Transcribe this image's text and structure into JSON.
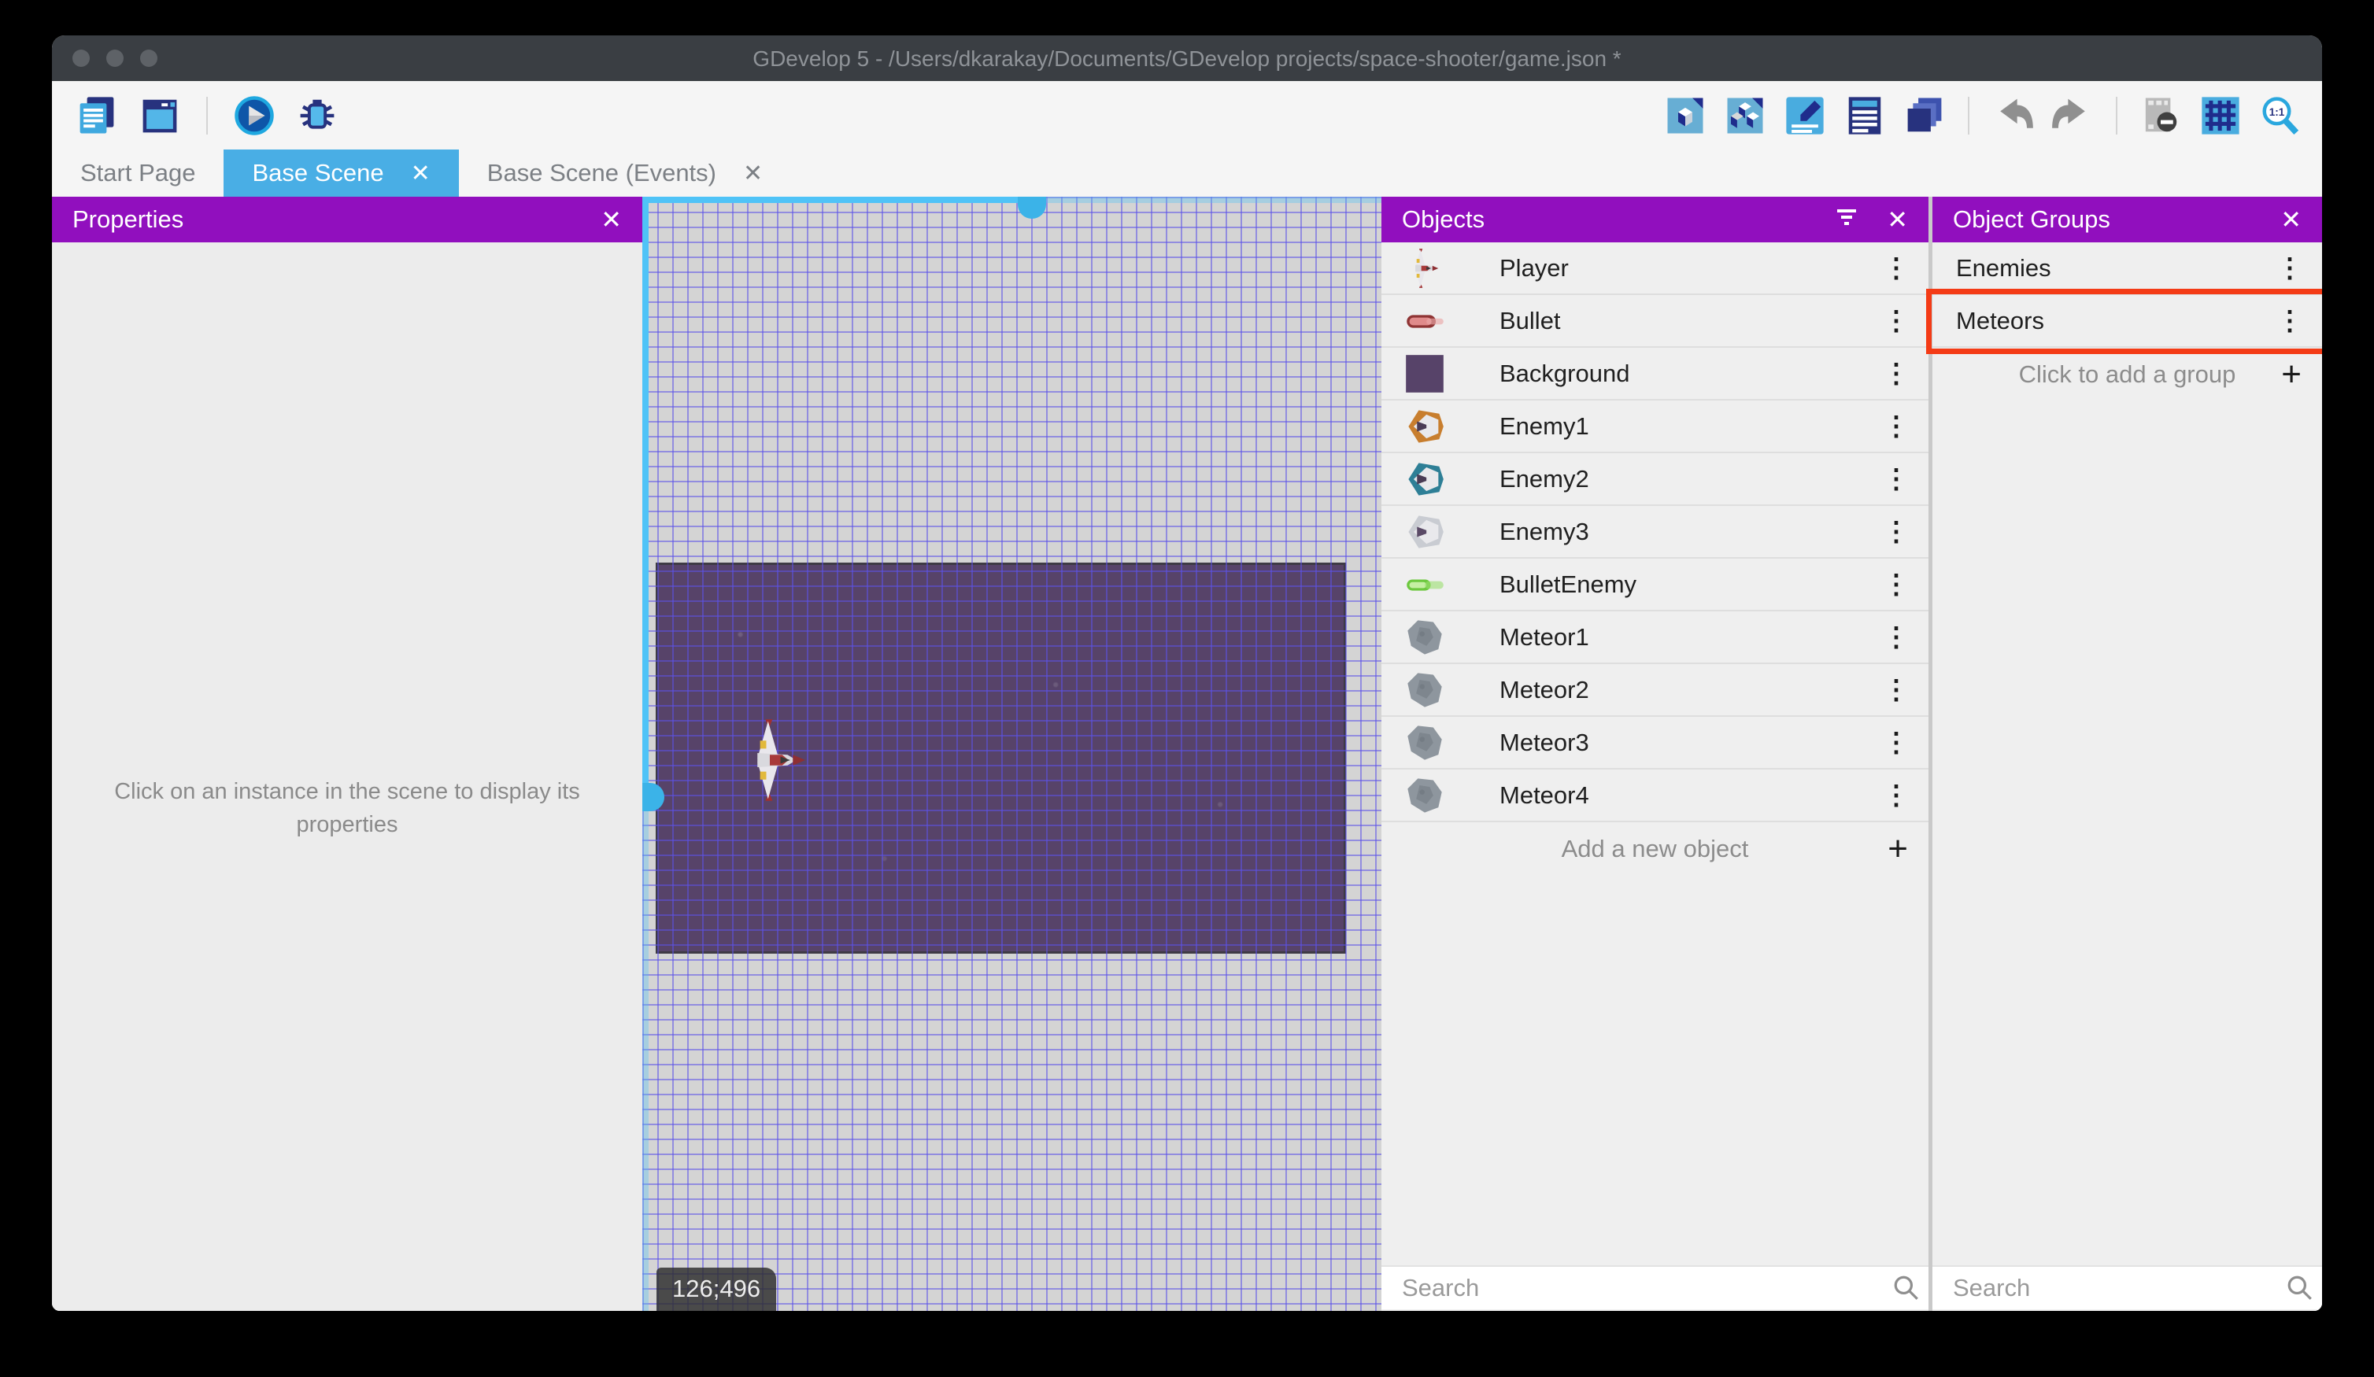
{
  "window": {
    "title": "GDevelop 5 - /Users/dkarakay/Documents/GDevelop projects/space-shooter/game.json *"
  },
  "toolbar": {
    "left_icons": [
      "project-manager-icon",
      "scene-editor-icon",
      "divider",
      "play-icon",
      "debug-icon"
    ],
    "right_icons": [
      "object-icon",
      "object-groups-icon",
      "edit-properties-icon",
      "instances-list-icon",
      "layers-icon",
      "divider",
      "undo-icon",
      "redo-icon",
      "divider",
      "mask-icon",
      "grid-icon",
      "zoom-1-1-icon"
    ]
  },
  "tabs": [
    {
      "label": "Start Page",
      "active": false,
      "closable": false
    },
    {
      "label": "Base Scene",
      "active": true,
      "closable": true
    },
    {
      "label": "Base Scene (Events)",
      "active": false,
      "closable": true
    }
  ],
  "properties_panel": {
    "title": "Properties",
    "empty_message": "Click on an instance in the scene to display its properties"
  },
  "scene_canvas": {
    "coordinates": "126;496"
  },
  "objects_panel": {
    "title": "Objects",
    "items": [
      {
        "label": "Player",
        "icon": "player-ship-icon"
      },
      {
        "label": "Bullet",
        "icon": "bullet-icon"
      },
      {
        "label": "Background",
        "icon": "background-icon"
      },
      {
        "label": "Enemy1",
        "icon": "enemy1-icon"
      },
      {
        "label": "Enemy2",
        "icon": "enemy2-icon"
      },
      {
        "label": "Enemy3",
        "icon": "enemy3-icon"
      },
      {
        "label": "BulletEnemy",
        "icon": "bullet-enemy-icon"
      },
      {
        "label": "Meteor1",
        "icon": "meteor-icon"
      },
      {
        "label": "Meteor2",
        "icon": "meteor-icon"
      },
      {
        "label": "Meteor3",
        "icon": "meteor-icon"
      },
      {
        "label": "Meteor4",
        "icon": "meteor-icon"
      }
    ],
    "add_label": "Add a new object",
    "search_placeholder": "Search"
  },
  "groups_panel": {
    "title": "Object Groups",
    "items": [
      {
        "label": "Enemies",
        "highlighted": false
      },
      {
        "label": "Meteors",
        "highlighted": true
      }
    ],
    "add_label": "Click to add a group",
    "search_placeholder": "Search"
  },
  "colors": {
    "accent_purple": "#910FBE",
    "tab_active_blue": "#49AEE5",
    "highlight_red": "#F43B16",
    "scrollbar_blue": "#3BB3E8",
    "scene_background_rect": "#574369"
  }
}
